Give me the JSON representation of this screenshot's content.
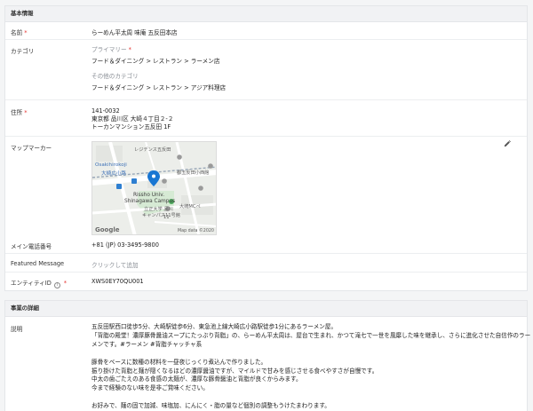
{
  "basic": {
    "header": "基本情報",
    "name": {
      "label": "名前",
      "required": "*",
      "value": "らーめん平太周 味庵 五反田本店"
    },
    "category": {
      "label": "カテゴリ",
      "primary_label": "プライマリー",
      "primary_required": "*",
      "primary_value": "フード＆ダイニング > レストラン > ラーメン店",
      "other_label": "その他のカテゴリ",
      "other_value": "フード＆ダイニング > レストラン > アジア料理店"
    },
    "address": {
      "label": "住所",
      "required": "*",
      "lines": [
        "141-0032",
        "東京都 品川区 大崎４丁目２-２",
        "トーカンマンション五反田 1F"
      ]
    },
    "map_marker": {
      "label": "マップマーカー",
      "edit_icon": "pencil-icon",
      "map_labels": {
        "top": "レジデンス五反田",
        "station_en": "Osakihirokoji",
        "station_jp": "大崎広小路",
        "school_en_1": "Rissho Univ.",
        "school_en_2": "Shinagawa Campus",
        "school_jp_1": "立正大学 品川",
        "school_jp_2": "キャンパス11号館",
        "right_top": "都五反田小西館",
        "right_mid": "大崎MCペ",
        "near_station": "大崎広小路",
        "google": "Google",
        "map_data": "Map data ©2020",
        "number": "11"
      }
    },
    "phone": {
      "label": "メイン電話番号",
      "value": "+81 (JP) 03-3495-9800"
    },
    "featured": {
      "label": "Featured Message",
      "placeholder": "クリックして追加"
    },
    "entity": {
      "label": "エンティティID",
      "info_icon": "i",
      "required": "*",
      "value": "XWS0EY70QU001"
    }
  },
  "detail": {
    "header": "事業の詳細",
    "description": {
      "label": "説明",
      "lines": [
        "五反田駅西口徒歩5分、大崎駅徒歩6分、東急池上線大崎広小路駅徒歩1分にあるラーメン屋。",
        "「背脂の殿堂！濃厚豚骨醤油スープにたっぷり背脂」の、らーめん平太周は、屋台で生まれ、かつて滝七で一世を風靡した味を継承し、さらに進化させた自信作のラー",
        "メンです。#ラーメン #背脂チャッチャ系",
        "",
        "豚骨をベースに数種の材料を一昼夜じっくり煮込んで作りました。",
        "振り掛けた背脂と麺が隠くなるほどの濃厚醤油ですが、マイルドで甘みを感じさせる食べやすさが自慢です。",
        "中太の歯ごたえのある食感の太麺が、濃厚な豚骨醤油と背脂が良くからみます。",
        "今まで経験のない味を是非ご賞味ください。",
        "",
        "お好みで、麺の固で加減、味塩加、にんにく・脂の量など個別の調整もうけたまわります。"
      ]
    }
  }
}
